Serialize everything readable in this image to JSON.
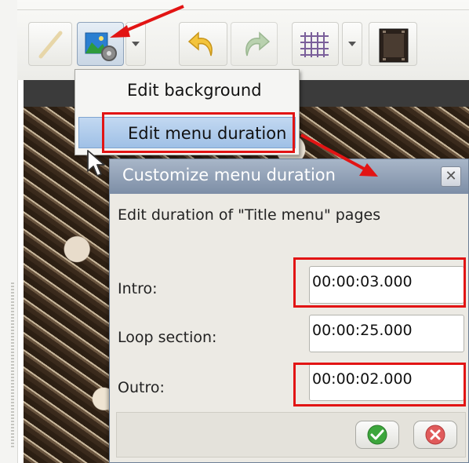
{
  "menu": {
    "items": [
      "Edit background",
      "Edit menu duration"
    ]
  },
  "dialog": {
    "title": "Customize menu duration",
    "description": "Edit duration of \"Title menu\" pages",
    "close_glyph": "✕",
    "fields": [
      {
        "label": "Intro:",
        "value": "00:00:03.000"
      },
      {
        "label": "Loop section:",
        "value": "00:00:25.000"
      },
      {
        "label": "Outro:",
        "value": "00:00:02.000"
      }
    ]
  },
  "toolbar": {
    "icons": [
      "pencil-icon",
      "background-settings-icon",
      "undo-icon",
      "redo-icon",
      "grid-icon",
      "film-strip-icon"
    ]
  },
  "colors": {
    "annotation_red": "#e21414",
    "menu_highlight": "#9fc0e6",
    "titlebar": "#7d8ea6"
  }
}
